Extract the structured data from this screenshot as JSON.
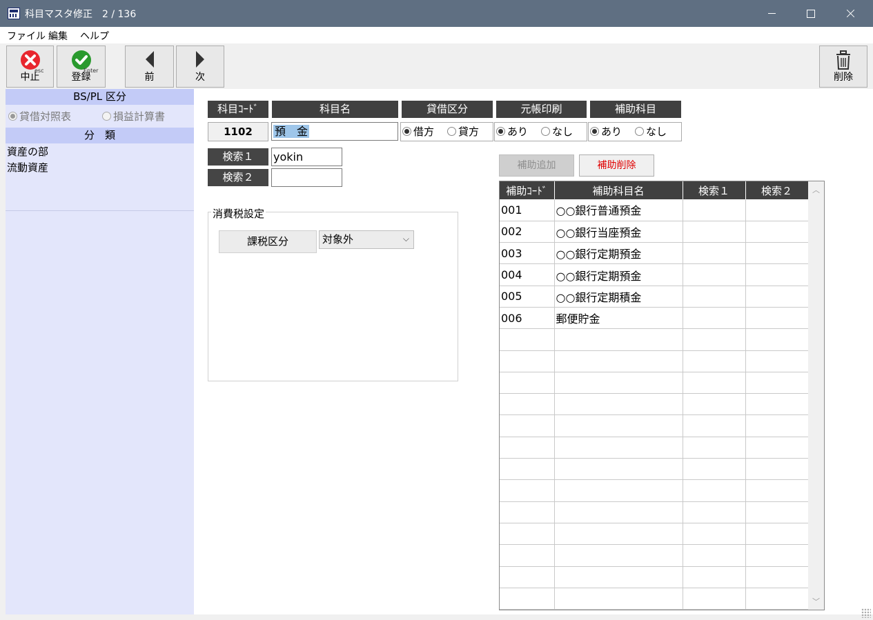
{
  "window": {
    "title": "科目マスタ修正　2 / 136"
  },
  "menu": [
    "ファイル",
    "編集",
    "ヘルプ"
  ],
  "toolbar": {
    "cancel": {
      "label": "中止",
      "sub": "esc"
    },
    "register": {
      "label": "登録",
      "sub": "Enter"
    },
    "prev": {
      "label": "前"
    },
    "next": {
      "label": "次"
    },
    "delete": {
      "label": "削除"
    }
  },
  "left_panel": {
    "bspl_header": "BS/PL 区分",
    "bspl_options": [
      {
        "label": "貸借対照表",
        "selected": true
      },
      {
        "label": "損益計算書",
        "selected": false
      }
    ],
    "class_header": "分　類",
    "class_items": [
      "資産の部",
      "流動資産"
    ]
  },
  "form": {
    "headers": {
      "code": "科目ｺｰﾄﾞ",
      "name": "科目名",
      "debit_credit": "貸借区分",
      "ledger_print": "元帳印刷",
      "sub_account": "補助科目"
    },
    "code": "1102",
    "name": "預　金",
    "debit_credit_options": [
      {
        "label": "借方",
        "selected": true
      },
      {
        "label": "貸方",
        "selected": false
      }
    ],
    "ledger_print_options": [
      {
        "label": "あり",
        "selected": true
      },
      {
        "label": "なし",
        "selected": false
      }
    ],
    "sub_account_options": [
      {
        "label": "あり",
        "selected": true
      },
      {
        "label": "なし",
        "selected": false
      }
    ],
    "search1_label": "検索１",
    "search1_value": "yokin",
    "search2_label": "検索２",
    "search2_value": ""
  },
  "tax": {
    "group_title": "消費税設定",
    "button": "課税区分",
    "selected": "対象外"
  },
  "sub_buttons": {
    "add": "補助追加",
    "delete": "補助削除",
    "delete_color": "#e00000"
  },
  "grid": {
    "columns": [
      "補助ｺｰﾄﾞ",
      "補助科目名",
      "検索１",
      "検索２"
    ],
    "rows": [
      [
        "001",
        "○○銀行普通預金",
        "",
        ""
      ],
      [
        "002",
        "○○銀行当座預金",
        "",
        ""
      ],
      [
        "003",
        "○○銀行定期預金",
        "",
        ""
      ],
      [
        "004",
        "○○銀行定期預金",
        "",
        ""
      ],
      [
        "005",
        "○○銀行定期積金",
        "",
        ""
      ],
      [
        "006",
        "郵便貯金",
        "",
        ""
      ]
    ],
    "empty_rows": 13
  },
  "colors": {
    "titlebar": "#5f6f82",
    "header_dark": "#404040",
    "left_panel": "#e3e6fb",
    "left_header": "#c3cbf7"
  }
}
